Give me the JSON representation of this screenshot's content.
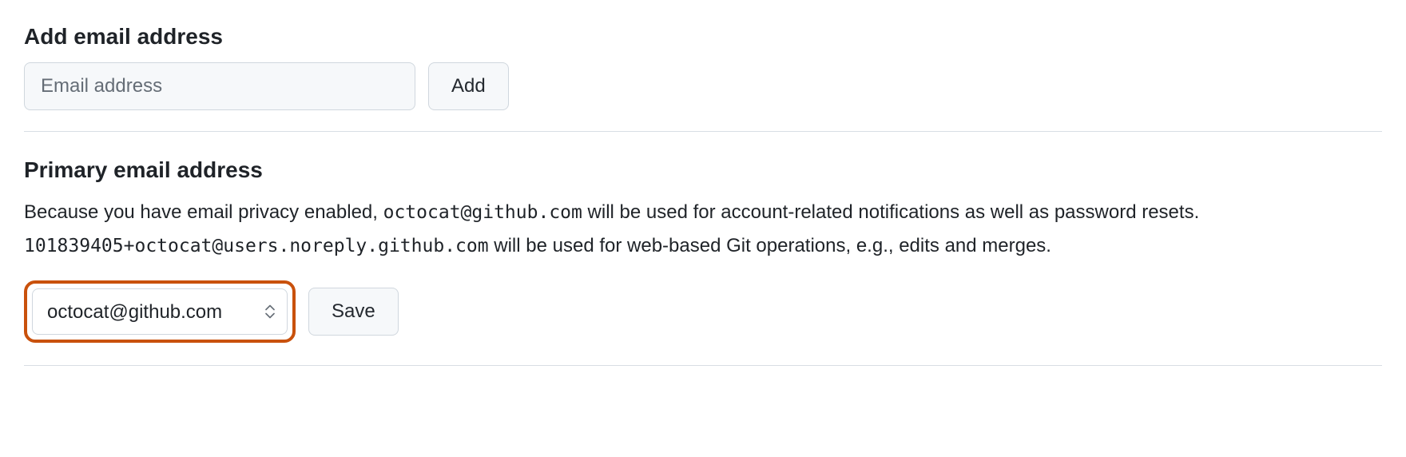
{
  "add_email": {
    "heading": "Add email address",
    "placeholder": "Email address",
    "add_button_label": "Add"
  },
  "primary_email": {
    "heading": "Primary email address",
    "description": {
      "part1": "Because you have email privacy enabled, ",
      "email_code": "octocat@github.com",
      "part2": " will be used for account-related notifications as well as password resets. ",
      "noreply_code": "101839405+octocat@users.noreply.github.com",
      "part3": " will be used for web-based Git operations, e.g., edits and merges."
    },
    "selected_option": "octocat@github.com",
    "save_button_label": "Save"
  }
}
